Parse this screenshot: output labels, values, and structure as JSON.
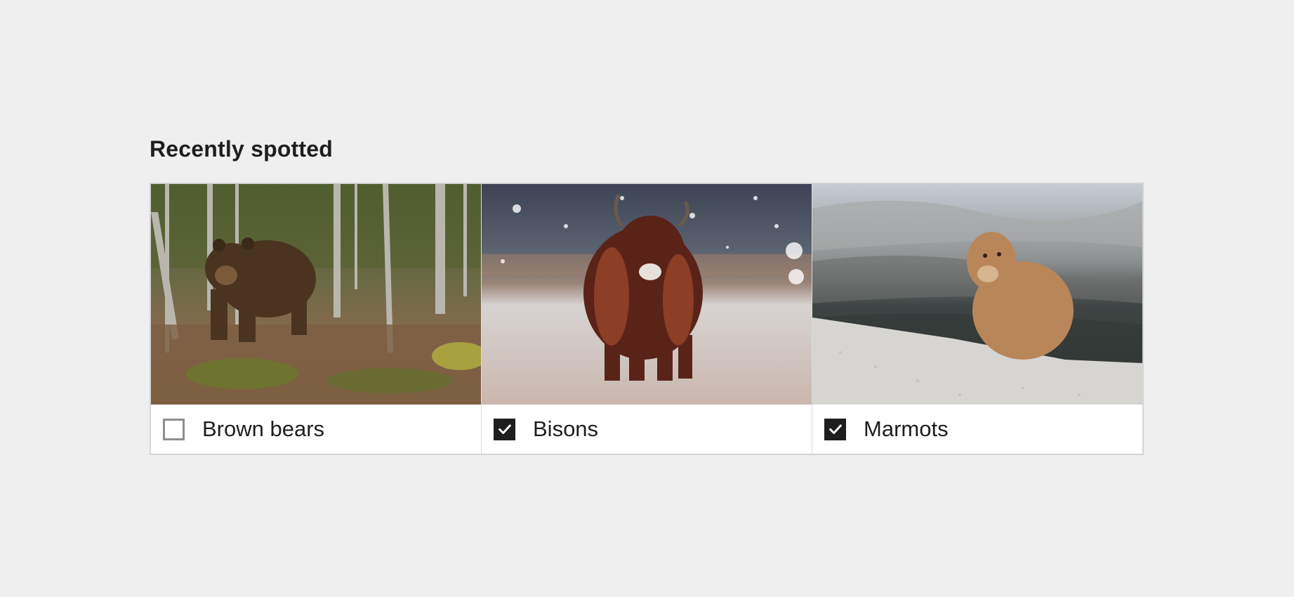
{
  "section": {
    "title": "Recently spotted"
  },
  "items": [
    {
      "label": "Brown bears",
      "checked": false,
      "image": "brown-bear-in-forest-photo"
    },
    {
      "label": "Bisons",
      "checked": true,
      "image": "bison-in-snow-photo"
    },
    {
      "label": "Marmots",
      "checked": true,
      "image": "marmot-on-hill-photo"
    }
  ],
  "colors": {
    "page_background": "#efefef",
    "checkbox_checked": "#1e1e1e",
    "checkbox_unchecked_border": "#8f8f8f",
    "text": "#1e1e1e"
  }
}
